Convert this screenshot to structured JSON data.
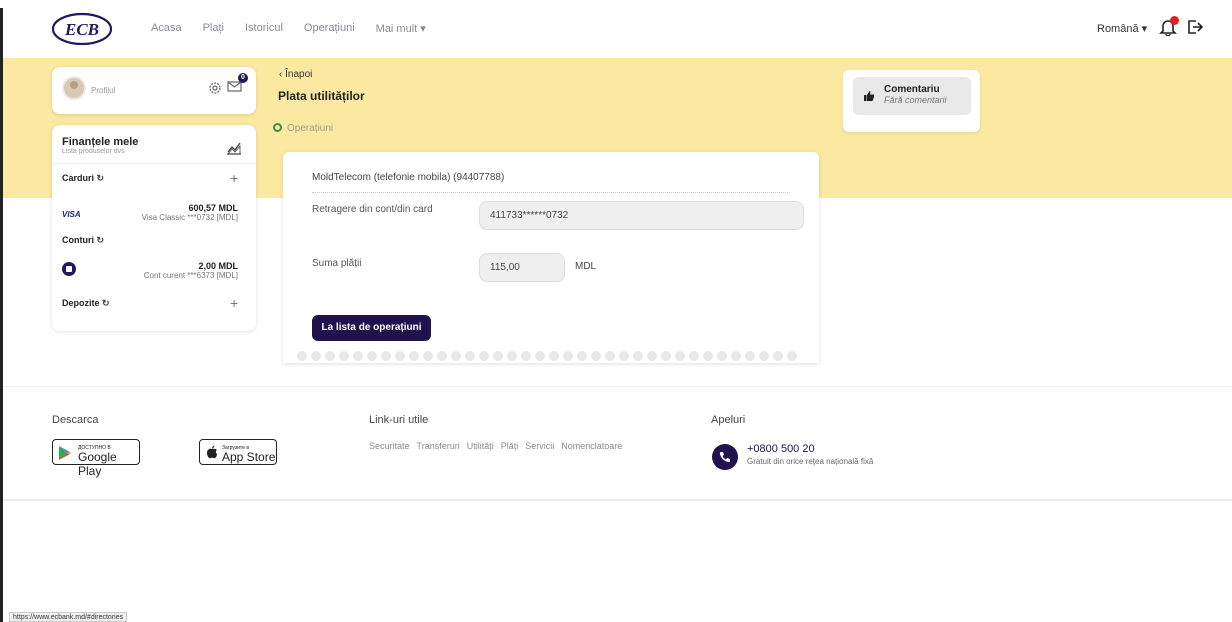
{
  "nav": {
    "logo": "ECB",
    "links": [
      "Acasa",
      "Plați",
      "Istoricul",
      "Operațiuni",
      "Mai mult ▾"
    ],
    "language": "Română ▾",
    "notification_badge": ""
  },
  "profile": {
    "label": "Profilul",
    "mail_count": "0"
  },
  "finances": {
    "title": "Finanțele mele",
    "subtitle": "Lista produselor dvs",
    "cards_label": "Carduri",
    "card": {
      "brand": "VISA",
      "amount": "600,57  MDL",
      "desc": "Visa Classic ***0732 [MDL]"
    },
    "accounts_label": "Conturi",
    "account": {
      "amount": "2,00  MDL",
      "desc": "Cont curent ***6373 [MDL]"
    },
    "deposits_label": "Depozite"
  },
  "header": {
    "back": "‹  Înapoi",
    "title": "Plata utilităților",
    "ops_link": "Operațiuni"
  },
  "payment": {
    "service": "MoldTelecom (telefonie mobila) (94407788)",
    "withdraw_label": "Retragere din cont/din card",
    "withdraw_value": "411733******0732",
    "amount_label": "Suma plății",
    "amount_value": "115,00",
    "currency": "MDL",
    "button": "La lista de operațiuni"
  },
  "comment": {
    "title": "Comentariu",
    "subtitle": "Fără comentarii"
  },
  "footer": {
    "download_label": "Descarca",
    "google_small": "ДОСТУПНО В",
    "google_big": "Google Play",
    "apple_small": "Загрузите в",
    "apple_big": "App Store",
    "links_label": "Link-uri utile",
    "links": [
      "Securitate",
      "Transferuri",
      "Utilități",
      "Plăți",
      "Servicii",
      "Nomenclatoare"
    ],
    "calls_label": "Apeluri",
    "phone": "+0800 500 20",
    "phone_sub": "Gratuit din orice rețea națională fixă"
  },
  "status_url": "https://www.ecbank.md/#directories",
  "colors": {
    "band": "#fbe9a1",
    "primary": "#20124d",
    "badge": "#e0201b"
  }
}
